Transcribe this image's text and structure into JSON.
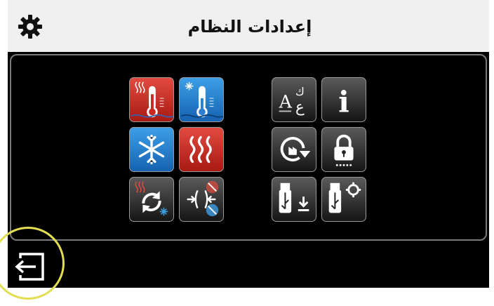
{
  "header": {
    "title": "إعدادات النظام",
    "settings_icon": "gear-icon"
  },
  "tiles": [
    {
      "name": "heating-temperature-tile",
      "icon": "thermometer-heat-icon",
      "color": "#c8281f"
    },
    {
      "name": "cooling-temperature-tile",
      "icon": "thermometer-cool-icon",
      "color": "#2a7fd0"
    },
    {
      "name": "cooling-mode-tile",
      "icon": "snowflake-icon",
      "color": "#2a7fd0"
    },
    {
      "name": "heating-mode-tile",
      "icon": "heat-waves-icon",
      "color": "#c8281f"
    },
    {
      "name": "changeover-mode-tile",
      "icon": "heat-cool-changeover-icon",
      "color": "#2a2a2a"
    },
    {
      "name": "deadband-tile",
      "icon": "deadband-icon",
      "color": "#2a2a2a"
    },
    {
      "name": "language-tile",
      "icon": "language-icon",
      "color": "#2a2a2a",
      "glyph_latin": "A",
      "glyph_arabic": "ع",
      "glyph_small": "ك"
    },
    {
      "name": "info-tile",
      "icon": "info-icon",
      "color": "#2a2a2a",
      "glyph": "i"
    },
    {
      "name": "factory-reset-tile",
      "icon": "factory-reset-icon",
      "color": "#2a2a2a"
    },
    {
      "name": "lock-tile",
      "icon": "lock-icon",
      "color": "#2a2a2a"
    },
    {
      "name": "usb-download-tile",
      "icon": "usb-download-icon",
      "color": "#2a2a2a"
    },
    {
      "name": "usb-settings-tile",
      "icon": "usb-settings-icon",
      "color": "#2a2a2a"
    }
  ],
  "footer": {
    "back_icon": "exit-icon",
    "highlight_color": "#e3dd52"
  }
}
